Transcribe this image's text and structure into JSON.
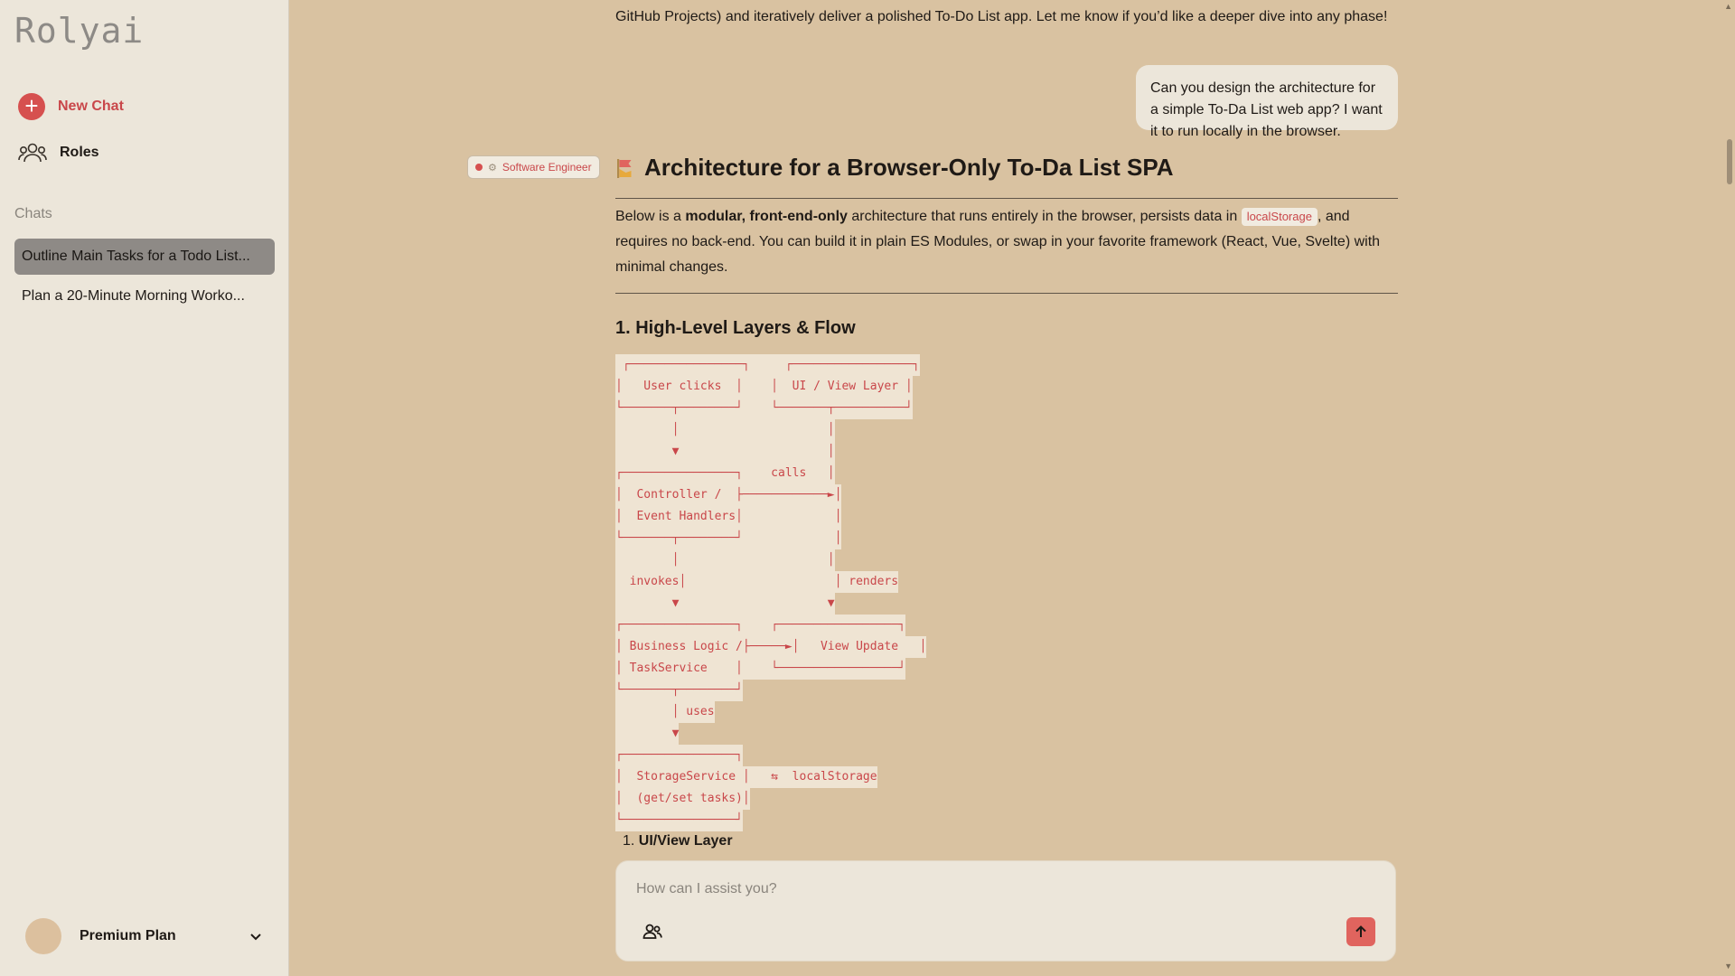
{
  "sidebar": {
    "logo": "Rolyai",
    "new_chat_label": "New Chat",
    "roles_label": "Roles",
    "chats_heading": "Chats",
    "chats": [
      {
        "title": "Outline Main Tasks for a Todo List..."
      },
      {
        "title": "Plan a 20-Minute Morning Worko..."
      }
    ],
    "account": {
      "plan": "Premium Plan"
    }
  },
  "conversation": {
    "previous_text": "GitHub Projects) and iteratively deliver a polished To-Do List app. Let me know if you’d like a deeper dive into any phase!",
    "user_message": "Can you design the architecture for a simple To-Da List web app? I want it to run locally in the browser.",
    "role_badge": "Software Engineer",
    "assistant": {
      "title": "Architecture for a Browser-Only To-Da List SPA",
      "intro_1": "Below is a ",
      "intro_bold": "modular, front-end-only",
      "intro_2": " architecture that runs entirely in the browser, persists data in ",
      "intro_code": "localStorage",
      "intro_3": ", and requires no back-end. You can build it in plain ES Modules, or swap in your favorite framework (React, Vue, Svelte) with minimal changes.",
      "section_title": "1. High-Level Layers & Flow",
      "diagram_lines": [
        " ┌────────────────┐     ┌─────────────────┐",
        "│   User clicks  │    │  UI / View Layer │",
        "└───────┬────────┘    └───────┬──────────┘",
        "        │                     │",
        "        ▼                     │",
        "┌────────────────┐    calls   │",
        "│  Controller /  ├────────────►│",
        "│  Event Handlers│             │",
        "└───────┬────────┘             │",
        "        │                     │",
        "  invokes│                     │ renders",
        "        ▼                     ▼",
        "┌────────────────┐    ┌─────────────────┐",
        "│ Business Logic /├─────►│   View Update   │",
        "│ TaskService    │    └─────────────────┘",
        "└───────┬────────┘",
        "        │ uses",
        "        ▼",
        "┌────────────────┐",
        "│  StorageService │   ⇆  localStorage",
        "│  (get/set tasks)│",
        "└────────────────┘"
      ],
      "list_item_number": "1.",
      "list_item_label": "UI/View Layer"
    }
  },
  "composer": {
    "placeholder": "How can I assist you?"
  },
  "colors": {
    "accent": "#d6504f",
    "background": "#d9c2a1",
    "sidebar": "#ece6da"
  }
}
